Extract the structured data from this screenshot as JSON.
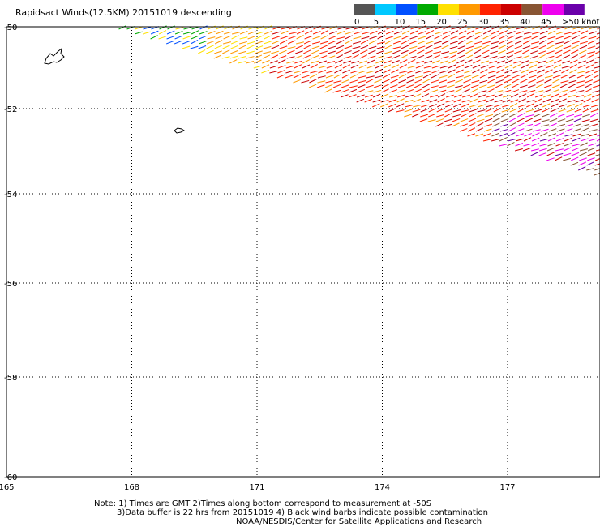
{
  "title": "Rapidsact Winds(12.5KM) 20151019 descending",
  "colorbar": {
    "ticks": [
      "0",
      "5",
      "10",
      "15",
      "20",
      "25",
      "30",
      "35",
      "40",
      "45",
      ">50 knots"
    ],
    "colors": [
      "#555555",
      "#00c8ff",
      "#0050ff",
      "#00aa00",
      "#ffe000",
      "#ff9900",
      "#ff2200",
      "#cc0000",
      "#885533",
      "#ee00ee",
      "#6a00aa"
    ]
  },
  "map": {
    "lat_ticks": [
      "-50",
      "-52",
      "-54",
      "-56",
      "-58",
      "-60"
    ],
    "lon_ticks": [
      "165",
      "168",
      "171",
      "174",
      "177"
    ],
    "lat_range": [
      -60,
      -50
    ],
    "lon_range": [
      165,
      179.2
    ],
    "grid": "dotted"
  },
  "notes": [
    "Note: 1) Times are GMT 2)Times along bottom correspond to measurement at -50S",
    "3)Data buffer is 22 hrs from 20151019 4) Black wind barbs indicate possible contamination",
    "NOAA/NESDIS/Center for Satellite Applications and Research"
  ],
  "swath": {
    "edge_lon": [
      167.5,
      179.2
    ],
    "edge_lat": [
      -50.0,
      -53.6
    ],
    "wind_speed_range_knots": [
      15,
      50
    ]
  }
}
